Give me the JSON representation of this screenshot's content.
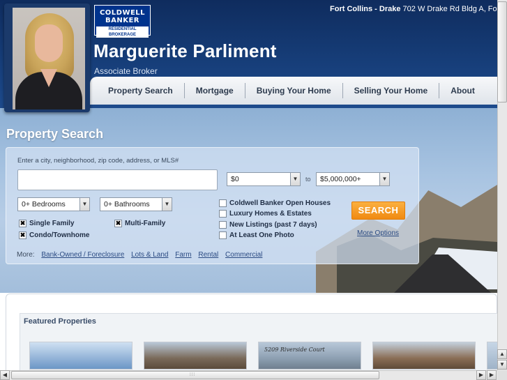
{
  "header": {
    "logo": {
      "line1": "COLDWELL",
      "line2": "BANKER",
      "line3": "RESIDENTIAL BROKERAGE"
    },
    "agent_name": "Marguerite Parliment",
    "agent_title": "Associate Broker",
    "office_name": "Fort Collins - Drake",
    "office_address": "702 W Drake Rd Bldg A, Fo"
  },
  "nav": {
    "items": [
      "Property Search",
      "Mortgage",
      "Buying Your Home",
      "Selling Your Home",
      "About"
    ]
  },
  "search": {
    "title": "Property Search",
    "location_label": "Enter a city, neighborhood, zip code, address, or MLS#",
    "location_value": "",
    "min_price": "$0",
    "to_label": "to",
    "max_price": "$5,000,000+",
    "bedrooms": "0+ Bedrooms",
    "bathrooms": "0+ Bathrooms",
    "property_types": [
      {
        "label": "Single Family",
        "checked": true
      },
      {
        "label": "Multi-Family",
        "checked": true
      },
      {
        "label": "Condo/Townhome",
        "checked": true
      }
    ],
    "filters": [
      {
        "label": "Coldwell Banker Open Houses",
        "checked": false
      },
      {
        "label": "Luxury Homes & Estates",
        "checked": false
      },
      {
        "label": "New Listings (past 7 days)",
        "checked": false
      },
      {
        "label": "At Least One Photo",
        "checked": false
      }
    ],
    "search_button": "SEARCH",
    "more_options": "More Options",
    "more_label": "More:",
    "more_links": [
      "Bank-Owned / Foreclosure",
      "Lots & Land",
      "Farm",
      "Rental",
      "Commercial"
    ]
  },
  "featured": {
    "title": "Featured Properties",
    "thumb_text": "5209 Riverside Court"
  },
  "colors": {
    "header_bg": "#163d78",
    "accent_orange": "#f08a12",
    "link": "#2a4a82"
  }
}
